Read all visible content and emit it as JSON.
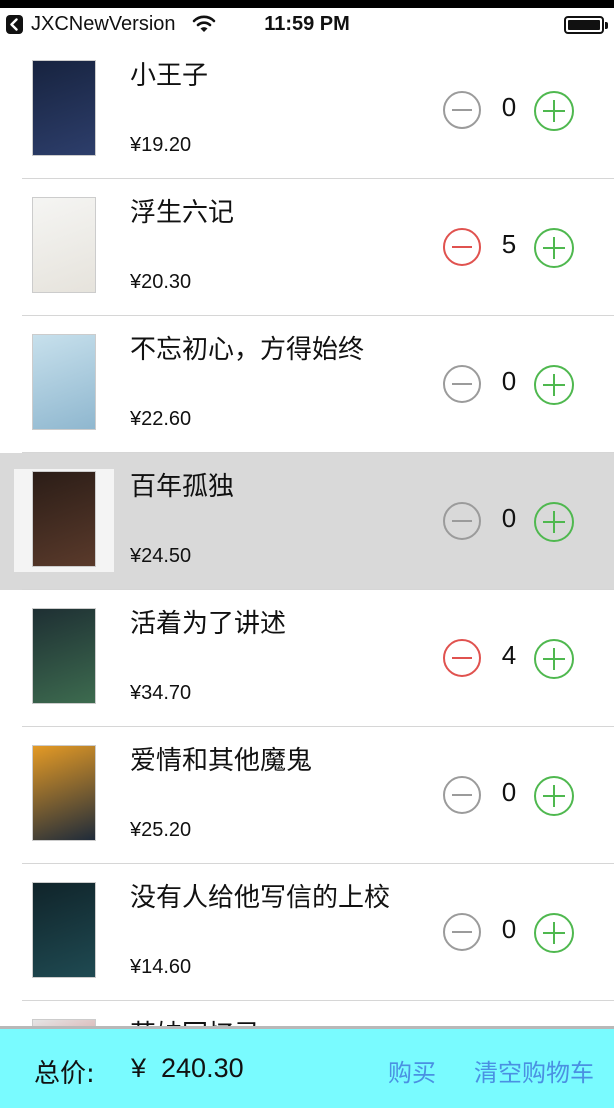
{
  "status": {
    "carrier": "JXCNewVersion",
    "time": "11:59 PM"
  },
  "books": [
    {
      "title": "小王子",
      "price": "¥19.20",
      "qty": "0",
      "minus_active": false,
      "selected": false,
      "cover": [
        "#17233f",
        "#2d3e6b"
      ]
    },
    {
      "title": "浮生六记",
      "price": "¥20.30",
      "qty": "5",
      "minus_active": true,
      "selected": false,
      "cover": [
        "#f5f5f3",
        "#e6e3dc"
      ]
    },
    {
      "title": "不忘初心，方得始终",
      "price": "¥22.60",
      "qty": "0",
      "minus_active": false,
      "selected": false,
      "cover": [
        "#c7e0ec",
        "#8fb7cf"
      ]
    },
    {
      "title": "百年孤独",
      "price": "¥24.50",
      "qty": "0",
      "minus_active": false,
      "selected": true,
      "cover": [
        "#2b1d17",
        "#5a3a2b"
      ]
    },
    {
      "title": "活着为了讲述",
      "price": "¥34.70",
      "qty": "4",
      "minus_active": true,
      "selected": false,
      "cover": [
        "#1e2f33",
        "#3d6b4f"
      ]
    },
    {
      "title": "爱情和其他魔鬼",
      "price": "¥25.20",
      "qty": "0",
      "minus_active": false,
      "selected": false,
      "cover": [
        "#e49a25",
        "#1f2b3a"
      ]
    },
    {
      "title": "没有人给他写信的上校",
      "price": "¥14.60",
      "qty": "0",
      "minus_active": false,
      "selected": false,
      "cover": [
        "#10242a",
        "#1f4a52"
      ]
    },
    {
      "title": "苦妓回忆录",
      "price": "",
      "qty": "",
      "minus_active": false,
      "selected": false,
      "cover": [
        "#e5e5e5",
        "#c44d4d"
      ]
    }
  ],
  "footer": {
    "total_label": "总价:",
    "total_value": "¥  240.30",
    "buy_label": "购买",
    "clear_label": "清空购物车"
  },
  "colors": {
    "minus_active": "#e0524f",
    "minus_inactive": "#9b9b9b",
    "plus": "#4fb84f",
    "footer_bg": "#79fbff",
    "link": "#4a90e2"
  }
}
